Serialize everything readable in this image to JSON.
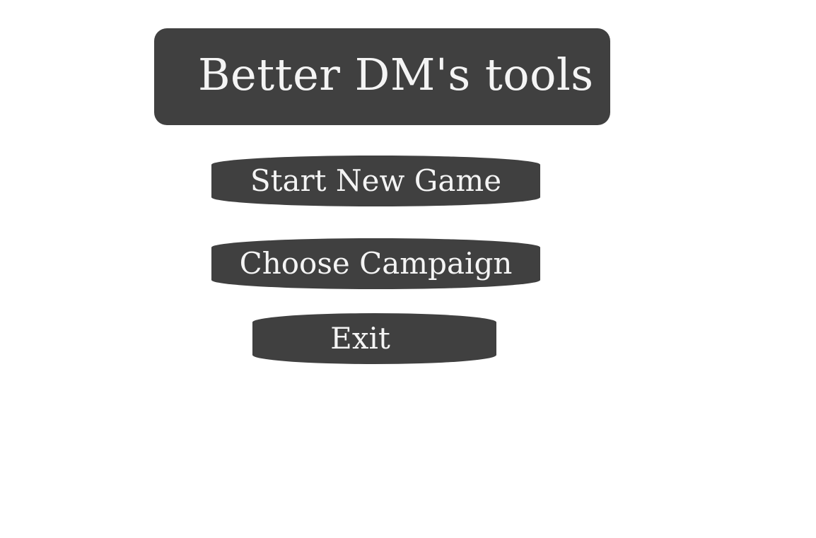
{
  "title": "Better DM's tools",
  "menu": {
    "start_new_game": "Start New Game",
    "choose_campaign": "Choose Campaign",
    "exit": "Exit"
  },
  "colors": {
    "background": "#ffffff",
    "panel": "#404040",
    "text": "#f4f4f4"
  }
}
